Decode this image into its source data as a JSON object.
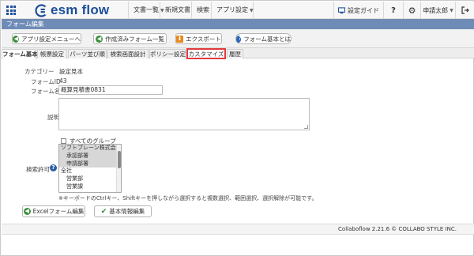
{
  "header": {
    "logo_text": "esm flow",
    "menu": [
      {
        "label": "文書一覧",
        "has_dropdown": true
      },
      {
        "label": "新規文書",
        "has_dropdown": false
      },
      {
        "label": "検索",
        "has_dropdown": false
      },
      {
        "label": "アプリ設定",
        "has_dropdown": true
      }
    ],
    "settings_guide_label": "設定ガイド",
    "help_label": "?",
    "gear_icon": "gear-icon",
    "user_label": "申請太郎",
    "logout_icon": "logout-icon"
  },
  "page_title": "フォーム編集",
  "toolbar": {
    "back_label": "アプリ設定メニューへ",
    "list_label": "作成済みフォーム一覧",
    "export_label": "エクスポート",
    "about_label": "フォーム基本とは"
  },
  "tabs": [
    {
      "label": "フォーム基本",
      "active": true
    },
    {
      "label": "帳票設定"
    },
    {
      "label": "パーツ並び順"
    },
    {
      "label": "検索画面設計"
    },
    {
      "label": "ポリシー設定"
    },
    {
      "label": "カスタマイズ",
      "highlighted": true
    },
    {
      "label": "履歴"
    }
  ],
  "form": {
    "category_label": "カテゴリー",
    "category_value": "設定見本",
    "form_id_label": "フォームID",
    "form_id_value": "43",
    "form_name_label": "フォーム名",
    "form_name_value": "概算見積書0831",
    "description_label": "説明",
    "description_value": "",
    "search_permission_label": "検索許可",
    "all_groups_label": "すべてのグループ",
    "all_groups_checked": false,
    "groups": [
      {
        "label": "ソフトブレーン株式会社",
        "selected": true,
        "indent": 0
      },
      {
        "label": "承認部署",
        "selected": true,
        "indent": 1
      },
      {
        "label": "申請部署",
        "selected": true,
        "indent": 1
      },
      {
        "label": "全社",
        "selected": false,
        "indent": 0
      },
      {
        "label": "営業部",
        "selected": false,
        "indent": 1
      },
      {
        "label": "営業課",
        "selected": false,
        "indent": 1
      }
    ],
    "note": "※キーボードのCtrlキー、Shiftキーを押しながら選択すると複数選択、範囲選択、選択解除が可能です。"
  },
  "bottom_buttons": {
    "excel_label": "Excelフォーム編集",
    "basic_info_label": "基本情報編集"
  },
  "footer": {
    "text": "Collaboflow 2.21.6 © COLLABO STYLE INC."
  },
  "colors": {
    "brand": "#1d4f9b",
    "title_bar": "#6f8cb7",
    "highlight": "#e03a3a",
    "excel_icon": "#3e8f3e",
    "check_icon": "#2f8a2f",
    "export_icon": "#e68a1e"
  }
}
